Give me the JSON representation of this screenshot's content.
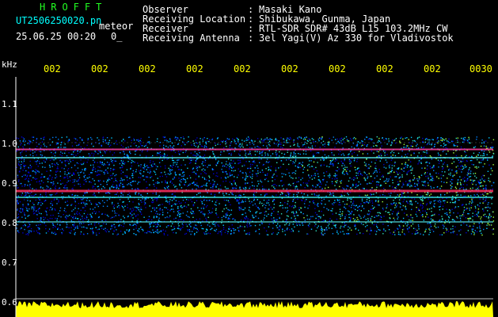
{
  "header": {
    "logo": "HROFFT",
    "filename": "UT2506250020.pn",
    "mode": "meteor",
    "date_time": "25.06.25 00:20",
    "counter": "0_",
    "fields": [
      {
        "label": "Observer",
        "value": "Masaki Kano"
      },
      {
        "label": "Receiving Location",
        "value": "Shibukawa, Gunma, Japan"
      },
      {
        "label": "Receiver",
        "value": "RTL-SDR SDR# 43dB L15 103.2MHz CW"
      },
      {
        "label": "Receiving Antenna",
        "value": "3el Yagi(V) Az 330 for Vladivostok"
      }
    ]
  },
  "axes": {
    "y_unit": "kHz",
    "y_ticks": [
      "1.1",
      "1.0",
      "0.9",
      "0.8",
      "0.7",
      "0.6"
    ],
    "x_ticks": [
      "002",
      "002",
      "002",
      "002",
      "002",
      "002",
      "002",
      "002",
      "002",
      "0030"
    ]
  },
  "colors": {
    "background": "#000000",
    "yellow": "#ffff00",
    "cyan": "#00ffff",
    "noise_low": "#0000c8",
    "noise_high": "#00c8ff",
    "signal_line": "#ff3060"
  }
}
